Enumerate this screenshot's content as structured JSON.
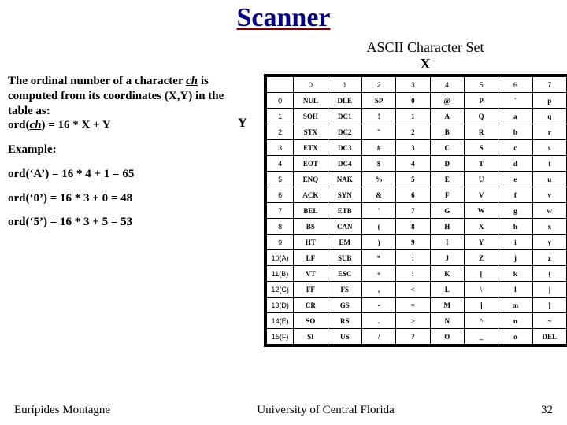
{
  "title": "Scanner",
  "subtitle_line1": "ASCII Character Set",
  "subtitle_line2": "X",
  "left": {
    "p1a": "The ordinal number of a character ",
    "p1b": "ch",
    "p1c": " is computed from its coordinates (X,Y) in the table as:",
    "p1d": "ord(",
    "p1e": "ch",
    "p1f": ") = 16 * X + Y",
    "example": "Example:",
    "ex1": "ord(‘A’) = 16 * 4 + 1 = 65",
    "ex2": "ord(‘0’) = 16 * 3 + 0 = 48",
    "ex3": "ord(‘5’) = 16 * 3 + 5 = 53"
  },
  "y_label": "Y",
  "col_headers": [
    "",
    "0",
    "1",
    "2",
    "3",
    "4",
    "5",
    "6",
    "7"
  ],
  "row_headers": [
    "0",
    "1",
    "2",
    "3",
    "4",
    "5",
    "6",
    "7",
    "8",
    "9",
    "10(A)",
    "11(B)",
    "12(C)",
    "13(D)",
    "14(E)",
    "15(F)"
  ],
  "rows": [
    [
      "NUL",
      "DLE",
      "SP",
      "0",
      "@",
      "P",
      "`",
      "p"
    ],
    [
      "SOH",
      "DC1",
      "!",
      "1",
      "A",
      "Q",
      "a",
      "q"
    ],
    [
      "STX",
      "DC2",
      "\"",
      "2",
      "B",
      "R",
      "b",
      "r"
    ],
    [
      "ETX",
      "DC3",
      "#",
      "3",
      "C",
      "S",
      "c",
      "s"
    ],
    [
      "EOT",
      "DC4",
      "$",
      "4",
      "D",
      "T",
      "d",
      "t"
    ],
    [
      "ENQ",
      "NAK",
      "%",
      "5",
      "E",
      "U",
      "e",
      "u"
    ],
    [
      "ACK",
      "SYN",
      "&",
      "6",
      "F",
      "V",
      "f",
      "v"
    ],
    [
      "BEL",
      "ETB",
      "'",
      "7",
      "G",
      "W",
      "g",
      "w"
    ],
    [
      "BS",
      "CAN",
      "(",
      "8",
      "H",
      "X",
      "h",
      "x"
    ],
    [
      "HT",
      "EM",
      ")",
      "9",
      "I",
      "Y",
      "i",
      "y"
    ],
    [
      "LF",
      "SUB",
      "*",
      ":",
      "J",
      "Z",
      "j",
      "z"
    ],
    [
      "VT",
      "ESC",
      "+",
      ";",
      "K",
      "[",
      "k",
      "{"
    ],
    [
      "FF",
      "FS",
      ",",
      "<",
      "L",
      "\\",
      "l",
      "|"
    ],
    [
      "CR",
      "GS",
      "-",
      "=",
      "M",
      "]",
      "m",
      "}"
    ],
    [
      "SO",
      "RS",
      ".",
      ">",
      "N",
      "^",
      "n",
      "~"
    ],
    [
      "SI",
      "US",
      "/",
      "?",
      "O",
      "_",
      "o",
      "DEL"
    ]
  ],
  "footer": {
    "left": "Eurípides Montagne",
    "center": "University of Central Florida",
    "right": "32"
  },
  "chart_data": {
    "type": "table",
    "title": "ASCII Character Set",
    "xlabel": "X",
    "ylabel": "Y",
    "columns": [
      "0",
      "1",
      "2",
      "3",
      "4",
      "5",
      "6",
      "7"
    ],
    "row_labels": [
      "0",
      "1",
      "2",
      "3",
      "4",
      "5",
      "6",
      "7",
      "8",
      "9",
      "10(A)",
      "11(B)",
      "12(C)",
      "13(D)",
      "14(E)",
      "15(F)"
    ],
    "cells": [
      [
        "NUL",
        "DLE",
        "SP",
        "0",
        "@",
        "P",
        "`",
        "p"
      ],
      [
        "SOH",
        "DC1",
        "!",
        "1",
        "A",
        "Q",
        "a",
        "q"
      ],
      [
        "STX",
        "DC2",
        "\"",
        "2",
        "B",
        "R",
        "b",
        "r"
      ],
      [
        "ETX",
        "DC3",
        "#",
        "3",
        "C",
        "S",
        "c",
        "s"
      ],
      [
        "EOT",
        "DC4",
        "$",
        "4",
        "D",
        "T",
        "d",
        "t"
      ],
      [
        "ENQ",
        "NAK",
        "%",
        "5",
        "E",
        "U",
        "e",
        "u"
      ],
      [
        "ACK",
        "SYN",
        "&",
        "6",
        "F",
        "V",
        "f",
        "v"
      ],
      [
        "BEL",
        "ETB",
        "'",
        "7",
        "G",
        "W",
        "g",
        "w"
      ],
      [
        "BS",
        "CAN",
        "(",
        "8",
        "H",
        "X",
        "h",
        "x"
      ],
      [
        "HT",
        "EM",
        ")",
        "9",
        "I",
        "Y",
        "i",
        "y"
      ],
      [
        "LF",
        "SUB",
        "*",
        ":",
        "J",
        "Z",
        "j",
        "z"
      ],
      [
        "VT",
        "ESC",
        "+",
        ";",
        "K",
        "[",
        "k",
        "{"
      ],
      [
        "FF",
        "FS",
        ",",
        "<",
        "L",
        "\\",
        "l",
        "|"
      ],
      [
        "CR",
        "GS",
        "-",
        "=",
        "M",
        "]",
        "m",
        "}"
      ],
      [
        "SO",
        "RS",
        ".",
        ">",
        "N",
        "^",
        "n",
        "~"
      ],
      [
        "SI",
        "US",
        "/",
        "?",
        "O",
        "_",
        "o",
        "DEL"
      ]
    ],
    "formula": "ord(ch) = 16 * X + Y",
    "examples": [
      {
        "ch": "A",
        "x": 4,
        "y": 1,
        "ord": 65
      },
      {
        "ch": "0",
        "x": 3,
        "y": 0,
        "ord": 48
      },
      {
        "ch": "5",
        "x": 3,
        "y": 5,
        "ord": 53
      }
    ]
  }
}
